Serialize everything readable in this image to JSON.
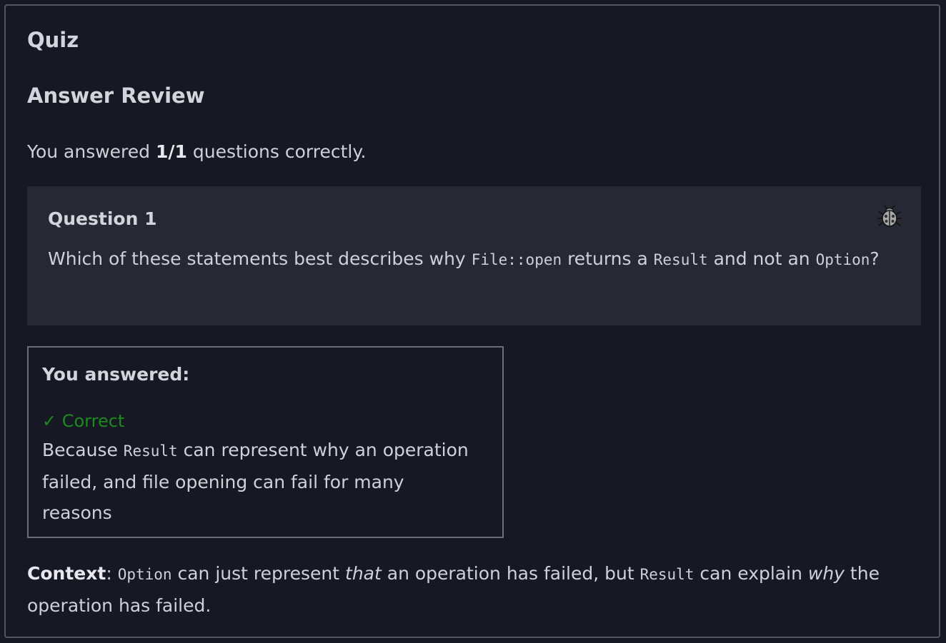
{
  "quiz": {
    "title": "Quiz",
    "review_title": "Answer Review",
    "score": {
      "prefix": "You answered ",
      "value": "1/1",
      "suffix": " questions correctly."
    }
  },
  "question": {
    "heading": "Question 1",
    "icon": "bug-icon",
    "text_parts": {
      "p1": "Which of these statements best describes why ",
      "code1": "File::open",
      "p2": " returns a ",
      "code2": "Result",
      "p3": " and not an ",
      "code3": "Option",
      "p4": "?"
    }
  },
  "answer": {
    "heading": "You answered:",
    "status": "✓ Correct",
    "status_color": "#1c8a1c",
    "text_parts": {
      "p1": "Because ",
      "code1": "Result",
      "p2": " can represent why an operation failed, and file opening can fail for many reasons"
    }
  },
  "context": {
    "label": "Context",
    "colon": ": ",
    "code1": "Option",
    "p1": " can just represent ",
    "em1": "that",
    "p2": " an operation has failed, but ",
    "code2": "Result",
    "p3": " can explain ",
    "em2": "why",
    "p4": " the operation has failed."
  }
}
